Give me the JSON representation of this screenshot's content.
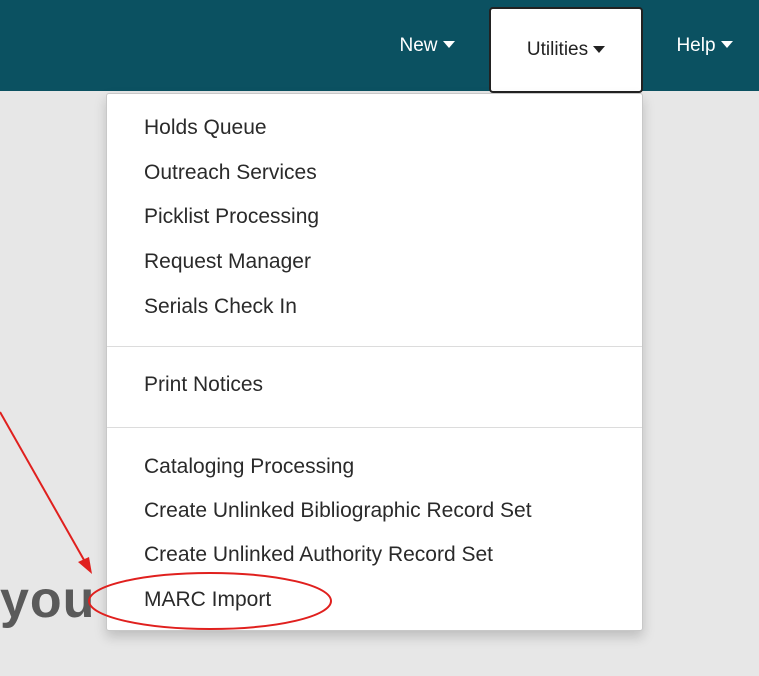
{
  "nav": {
    "new_label": "New",
    "utilities_label": "Utilities",
    "help_label": "Help"
  },
  "background_text": "you",
  "utilities_menu": {
    "group1": [
      "Holds Queue",
      "Outreach Services",
      "Picklist Processing",
      "Request Manager",
      "Serials Check In"
    ],
    "group2": [
      "Print Notices"
    ],
    "group3": [
      "Cataloging Processing",
      "Create Unlinked Bibliographic Record Set",
      "Create Unlinked Authority Record Set",
      "MARC Import"
    ]
  },
  "colors": {
    "navbar": "#0b5161",
    "annotation": "#e0201e",
    "background": "#e7e7e7"
  },
  "annotation": {
    "highlighted_item": "MARC Import",
    "shapes": [
      "arrow",
      "ellipse"
    ]
  }
}
